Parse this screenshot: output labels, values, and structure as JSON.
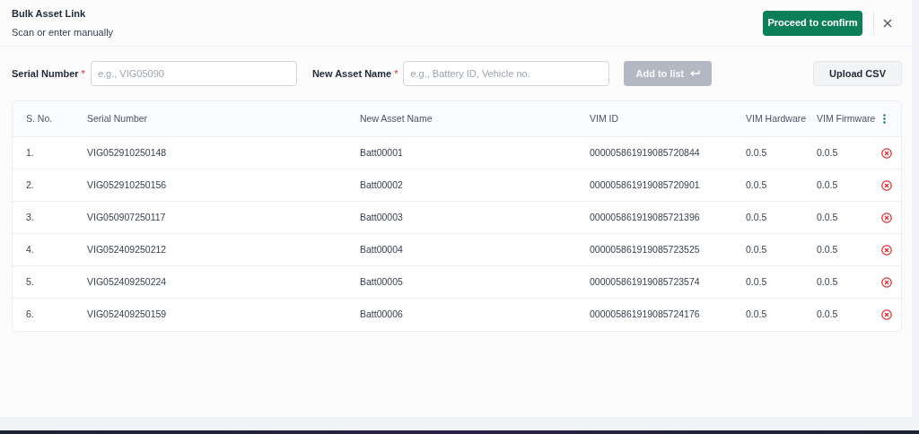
{
  "header": {
    "title": "Bulk Asset Link",
    "subtitle": "Scan or enter manually",
    "primary_button": "Proceed to confirm"
  },
  "form": {
    "serial_label": "Serial Number",
    "serial_required": "*",
    "serial_placeholder": "e.g., VIG05090",
    "name_label": "New Asset Name",
    "name_required": "*",
    "name_placeholder": "e.g., Battery ID, Vehicle no.",
    "add_button": {
      "label": "Add to list",
      "disabled": true
    },
    "upload_button": "Upload CSV"
  },
  "table": {
    "columns": [
      "S. No.",
      "Serial Number",
      "New Asset Name",
      "VIM ID",
      "VIM Hardware",
      "VIM Firmware"
    ],
    "rows": [
      [
        "1.",
        "VIG052910250148",
        "Batt00001",
        "000005861919085720844",
        "0.0.5",
        "0.0.5"
      ],
      [
        "2.",
        "VIG052910250156",
        "Batt00002",
        "000005861919085720901",
        "0.0.5",
        "0.0.5"
      ],
      [
        "3.",
        "VIG050907250117",
        "Batt00003",
        "000005861919085721396",
        "0.0.5",
        "0.0.5"
      ],
      [
        "4.",
        "VIG052409250212",
        "Batt00004",
        "000005861919085723525",
        "0.0.5",
        "0.0.5"
      ],
      [
        "5.",
        "VIG052409250224",
        "Batt00005",
        "000005861919085723574",
        "0.0.5",
        "0.0.5"
      ],
      [
        "6.",
        "VIG052409250159",
        "Batt00006",
        "000005861919085724176",
        "0.0.5",
        "0.0.5"
      ]
    ]
  }
}
